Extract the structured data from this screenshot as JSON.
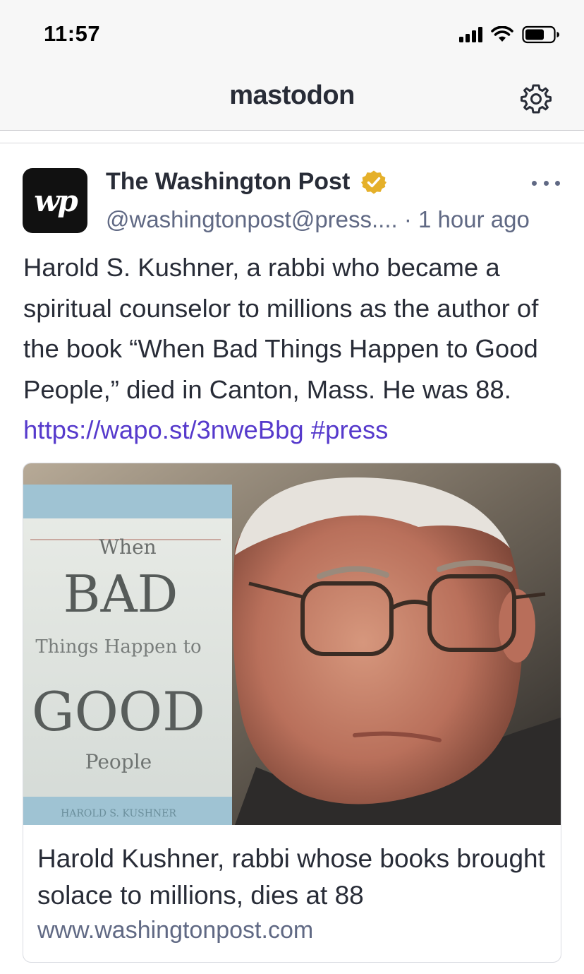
{
  "status_bar": {
    "time": "11:57"
  },
  "header": {
    "title": "mastodon",
    "settings_icon": "gear-icon"
  },
  "post": {
    "avatar_text": "wp",
    "display_name": "The Washington Post",
    "verified_icon": "verified-badge-icon",
    "handle": "@washingtonpost@press....",
    "separator": " · ",
    "timestamp": "1 hour ago",
    "text": "Harold S. Kushner, a rabbi who became a spiritual counselor to millions as the author of the book “When Bad Things Happen to Good People,” died in Canton, Mass. He was 88. ",
    "link": "https://wapo.st/3nweBbg",
    "hashtag": "#press",
    "link_color": "#563acc"
  },
  "card": {
    "image_book_text": {
      "when": "When",
      "bad": "BAD",
      "things": "Things Happen to",
      "good": "GOOD",
      "people": "People",
      "author": "HAROLD S. KUSHNER"
    },
    "title": "Harold Kushner, rabbi whose books brought solace to millions, dies at 88",
    "domain": "www.washingtonpost.com"
  },
  "colors": {
    "text": "#282c37",
    "secondary": "#606984",
    "verified": "#e5b02a"
  }
}
